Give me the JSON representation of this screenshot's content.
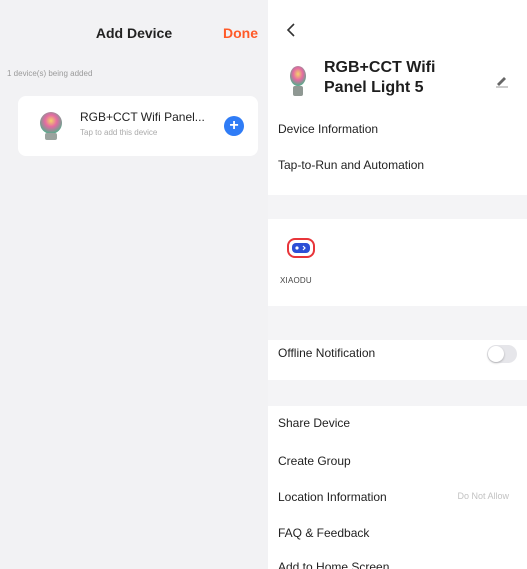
{
  "left_panel": {
    "title": "Add Device",
    "done_label": "Done",
    "adding_status": "1 device(s) being added",
    "device": {
      "name": "RGB+CCT Wifi Panel...",
      "hint": "Tap to add this device",
      "add_icon": "plus-circle-icon"
    }
  },
  "right_panel": {
    "back_icon": "chevron-left-icon",
    "device_title": "RGB+CCT Wifi Panel Light 5",
    "edit_icon": "pencil-icon",
    "menu": {
      "device_information": "Device Information",
      "tap_to_run": "Tap-to-Run and Automation"
    },
    "third_party_service": {
      "name": "XIAODU",
      "icon": "xiaodu-icon"
    },
    "offline_notification": {
      "label": "Offline Notification",
      "enabled": false
    },
    "more": {
      "share_device": "Share Device",
      "create_group": "Create Group",
      "location_information": "Location Information",
      "location_value": "Do Not Allow",
      "faq_feedback": "FAQ & Feedback",
      "add_to_home_screen": "Add to Home Screen"
    }
  },
  "colors": {
    "accent_done": "#ff5a28",
    "add_button": "#2f7cf6",
    "xiaodu_brand": "#e8353a"
  }
}
